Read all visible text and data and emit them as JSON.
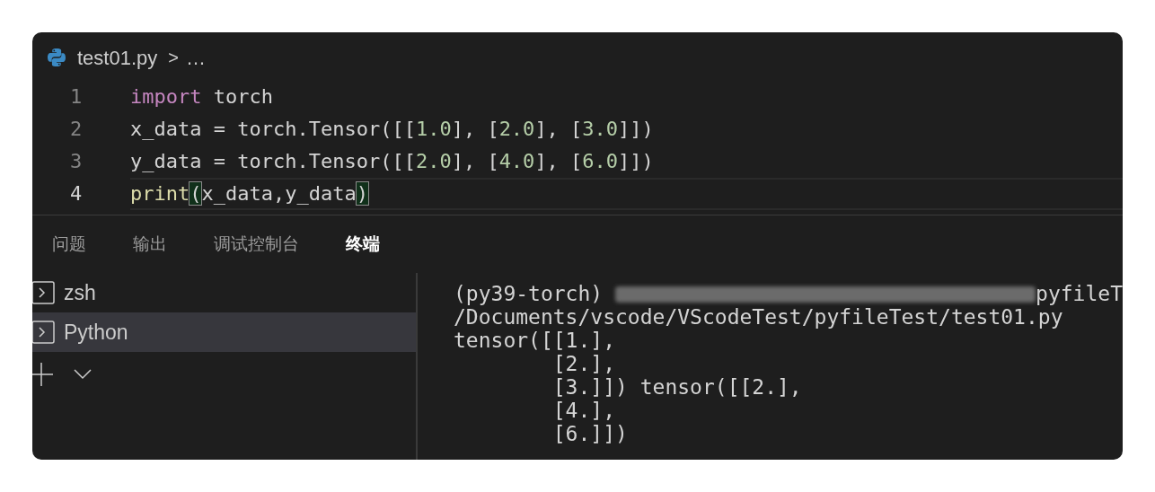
{
  "breadcrumb": {
    "file": "test01.py",
    "separator": ">",
    "more": "…"
  },
  "code_lines": [
    {
      "number": "1",
      "active": false,
      "tokens": [
        {
          "kind": "keyword",
          "text": "import"
        },
        {
          "kind": "plain",
          "text": " torch"
        }
      ]
    },
    {
      "number": "2",
      "active": false,
      "tokens": [
        {
          "kind": "plain",
          "text": "x_data = torch.Tensor([["
        },
        {
          "kind": "number",
          "text": "1.0"
        },
        {
          "kind": "plain",
          "text": "], ["
        },
        {
          "kind": "number",
          "text": "2.0"
        },
        {
          "kind": "plain",
          "text": "], ["
        },
        {
          "kind": "number",
          "text": "3.0"
        },
        {
          "kind": "plain",
          "text": "]])"
        }
      ]
    },
    {
      "number": "3",
      "active": false,
      "tokens": [
        {
          "kind": "plain",
          "text": "y_data = torch.Tensor([["
        },
        {
          "kind": "number",
          "text": "2.0"
        },
        {
          "kind": "plain",
          "text": "], ["
        },
        {
          "kind": "number",
          "text": "4.0"
        },
        {
          "kind": "plain",
          "text": "], ["
        },
        {
          "kind": "number",
          "text": "6.0"
        },
        {
          "kind": "plain",
          "text": "]])"
        }
      ]
    },
    {
      "number": "4",
      "active": true,
      "tokens": [
        {
          "kind": "function",
          "text": "print"
        },
        {
          "kind": "bracket",
          "text": "("
        },
        {
          "kind": "plain",
          "text": "x_data,y_data"
        },
        {
          "kind": "bracket",
          "text": ")"
        }
      ]
    }
  ],
  "panel_tabs": [
    {
      "label": "问题",
      "selected": false
    },
    {
      "label": "输出",
      "selected": false
    },
    {
      "label": "调试控制台",
      "selected": false
    },
    {
      "label": "终端",
      "selected": true
    }
  ],
  "terminals": [
    {
      "name": "zsh",
      "selected": false
    },
    {
      "name": "Python",
      "selected": true
    }
  ],
  "terminal_lines": [
    [
      {
        "kind": "text",
        "text": "(py39-torch) "
      },
      {
        "kind": "redacted"
      },
      {
        "kind": "text",
        "text": "pyfileT"
      }
    ],
    [
      {
        "kind": "text",
        "text": "/Documents/vscode/VScodeTest/pyfileTest/test01.py"
      }
    ],
    [
      {
        "kind": "text",
        "text": "tensor([[1.],"
      }
    ],
    [
      {
        "kind": "text",
        "text": "        [2.],"
      }
    ],
    [
      {
        "kind": "text",
        "text": "        [3.]]) tensor([[2.],"
      }
    ],
    [
      {
        "kind": "text",
        "text": "        [4.],"
      }
    ],
    [
      {
        "kind": "text",
        "text": "        [6.]])"
      }
    ]
  ]
}
